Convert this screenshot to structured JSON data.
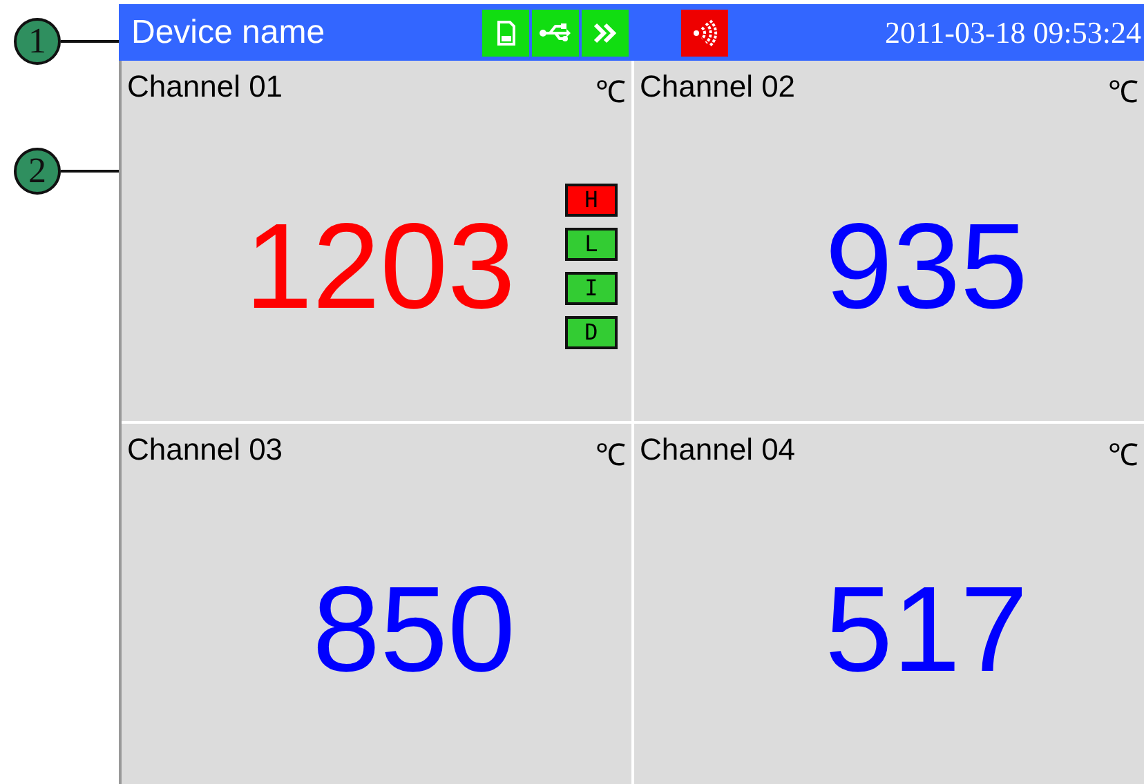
{
  "callouts": [
    "1",
    "2"
  ],
  "header": {
    "title": "Device name",
    "datetime": "2011-03-18 09:53:24",
    "status_icons": [
      {
        "kind": "sd-card",
        "alert": false
      },
      {
        "kind": "usb",
        "alert": false
      },
      {
        "kind": "forward",
        "alert": false
      },
      {
        "kind": "wireless",
        "alert": true
      }
    ]
  },
  "channels": [
    {
      "name": "Channel 01",
      "unit": "℃",
      "value": "1203",
      "alarm": true,
      "alarm_flags": [
        {
          "label": "H",
          "on": true
        },
        {
          "label": "L",
          "on": false
        },
        {
          "label": "I",
          "on": false
        },
        {
          "label": "D",
          "on": false
        }
      ]
    },
    {
      "name": "Channel 02",
      "unit": "℃",
      "value": "935",
      "alarm": false
    },
    {
      "name": "Channel 03",
      "unit": "℃",
      "value": "850",
      "alarm": false
    },
    {
      "name": "Channel 04",
      "unit": "℃",
      "value": "517",
      "alarm": false
    }
  ]
}
